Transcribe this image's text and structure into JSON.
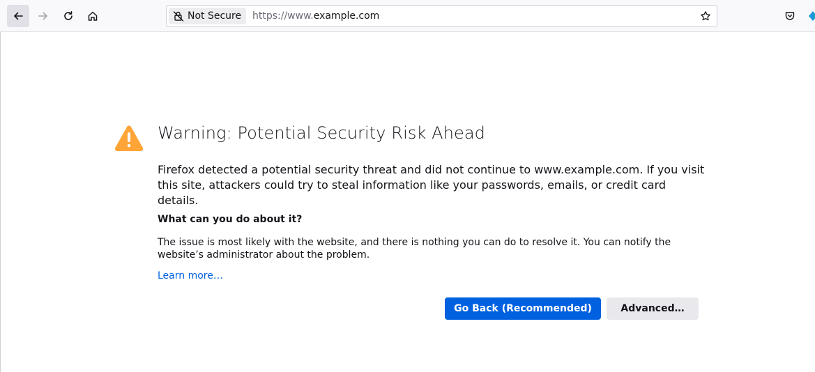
{
  "toolbar": {
    "icons": {
      "back": "arrow-left-icon",
      "forward": "arrow-right-icon",
      "reload": "reload-icon",
      "home": "home-icon",
      "bookmark": "star-icon",
      "pocket": "pocket-icon"
    },
    "urlbar": {
      "identity_label": "Not Secure",
      "url_protocol": "https://www.",
      "url_domain": "example.com"
    }
  },
  "error_page": {
    "title": "Warning: Potential Security Risk Ahead",
    "intro": "Firefox detected a potential security threat and did not continue to www.example.com. If you visit this site, attackers could try to steal information like your passwords, emails, or credit card details.",
    "subhead": "What can you do about it?",
    "body": "The issue is most likely with the website, and there is nothing you can do to resolve it. You can notify the website’s administrator about the problem.",
    "learn_more": "Learn more…",
    "buttons": {
      "go_back": "Go Back (Recommended)",
      "advanced": "Advanced…"
    }
  },
  "colors": {
    "accent": "#0061e0",
    "warning": "#ffa436",
    "text": "#15141a"
  }
}
